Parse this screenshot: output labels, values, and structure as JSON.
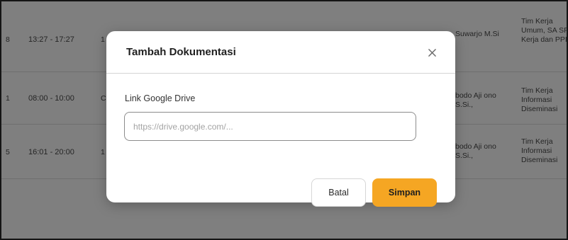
{
  "table": {
    "rows": [
      {
        "no": "8",
        "time": "13:27 - 17:27",
        "activity": "1",
        "name": "Suwarjo M.Si",
        "team": "Tim Kerja Umum, SA SPIP, Kerja dan PPID"
      },
      {
        "no": "1",
        "time": "08:00 - 10:00",
        "activity": "C",
        "name": "bodo Aji ono S.Si.,",
        "team": "Tim Kerja Informasi Diseminasi"
      },
      {
        "no": "5",
        "time": "16:01 - 20:00",
        "activity": "1",
        "name": "bodo Aji ono S.Si.,",
        "team": "Tim Kerja Informasi Diseminasi"
      }
    ]
  },
  "modal": {
    "title": "Tambah Dokumentasi",
    "close_icon": "close-icon",
    "field_label": "Link Google Drive",
    "input_value": "",
    "input_placeholder": "https://drive.google.com/...",
    "cancel_label": "Batal",
    "save_label": "Simpan"
  },
  "colors": {
    "accent": "#f5a623",
    "overlay": "rgba(0,0,0,0.50)"
  }
}
